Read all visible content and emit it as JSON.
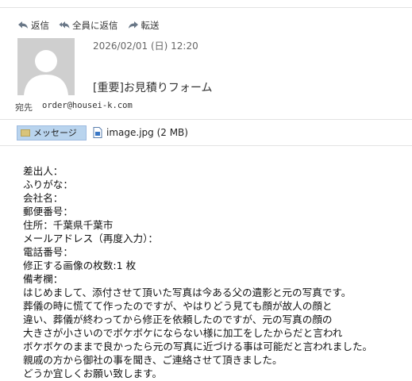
{
  "toolbar": {
    "reply_label": "返信",
    "reply_all_label": "全員に返信",
    "forward_label": "転送"
  },
  "message": {
    "date": "2026/02/01 (日) 12:20",
    "subject": "[重要]お見積りフォーム",
    "to_label": "宛先",
    "to_value": "order@housei-k.com"
  },
  "attachments": {
    "message_tab": "メッセージ",
    "file_label": "image.jpg (2 MB)"
  },
  "body": {
    "lines": [
      "差出人：",
      "ふりがな：",
      "会社名：",
      "郵便番号：",
      "住所：千葉県千葉市",
      "メールアドレス（再度入力）：",
      "電話番号：",
      "修正する画像の枚数:1 枚",
      "備考欄：",
      "はじめまして、添付させて頂いた写真は今ある父の遺影と元の写真です。",
      "葬儀の時に慌てて作ったのですが、やはりどう見ても顔が故人の顔と",
      "違い、葬儀が終わってから修正を依頼したのですが、元の写真の顔の",
      "大きさが小さいのでボケボケにならない様に加工をしたからだと言われ",
      "ボケボケのままで良かったら元の写真に近づける事は可能だと言われました。",
      "親戚の方から御社の事を聞き、ご連絡させて頂きました。",
      "どうか宜しくお願い致します。"
    ]
  }
}
